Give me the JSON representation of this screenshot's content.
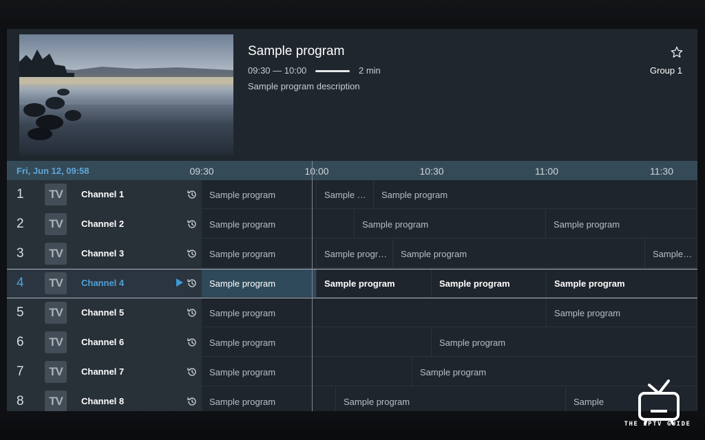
{
  "preview": {
    "title": "Sample program",
    "time_range": "09:30 — 10:00",
    "progress_fraction": 0.07,
    "remaining": "2 min",
    "description": "Sample program description",
    "group": "Group 1",
    "favorite_icon": "star-outline-icon"
  },
  "timebar": {
    "datetime": "Fri, Jun 12, 09:58",
    "ticks": [
      "09:30",
      "10:00",
      "10:30",
      "11:00",
      "11:30"
    ]
  },
  "channels": [
    {
      "number": "1",
      "logo": "TV",
      "name": "Channel 1",
      "selected": false,
      "programs": [
        [
          "Sample program",
          0,
          167
        ],
        [
          "Sample …",
          167,
          83
        ],
        [
          "Sample program",
          250,
          470
        ]
      ]
    },
    {
      "number": "2",
      "logo": "TV",
      "name": "Channel 2",
      "selected": false,
      "programs": [
        [
          "Sample program",
          0,
          222
        ],
        [
          "Sample program",
          222,
          278
        ],
        [
          "Sample program",
          500,
          220
        ]
      ]
    },
    {
      "number": "3",
      "logo": "TV",
      "name": "Channel 3",
      "selected": false,
      "programs": [
        [
          "Sample program",
          0,
          167
        ],
        [
          "Sample progr…",
          167,
          111
        ],
        [
          "Sample program",
          278,
          366
        ],
        [
          "Sample pro",
          644,
          76
        ]
      ]
    },
    {
      "number": "4",
      "logo": "TV",
      "name": "Channel 4",
      "selected": true,
      "programs": [
        [
          "Sample program",
          0,
          167
        ],
        [
          "Sample program",
          167,
          167
        ],
        [
          "Sample program",
          334,
          167
        ],
        [
          "Sample program",
          501,
          219
        ]
      ]
    },
    {
      "number": "5",
      "logo": "TV",
      "name": "Channel 5",
      "selected": false,
      "programs": [
        [
          "Sample program",
          0,
          501
        ],
        [
          "Sample program",
          501,
          219
        ]
      ]
    },
    {
      "number": "6",
      "logo": "TV",
      "name": "Channel 6",
      "selected": false,
      "programs": [
        [
          "Sample program",
          0,
          334
        ],
        [
          "Sample program",
          334,
          386
        ]
      ]
    },
    {
      "number": "7",
      "logo": "TV",
      "name": "Channel 7",
      "selected": false,
      "programs": [
        [
          "Sample program",
          0,
          306
        ],
        [
          "Sample program",
          306,
          414
        ]
      ]
    },
    {
      "number": "8",
      "logo": "TV",
      "name": "Channel 8",
      "selected": false,
      "programs": [
        [
          "Sample program",
          0,
          195
        ],
        [
          "Sample program",
          195,
          334
        ],
        [
          "Sample",
          529,
          191
        ]
      ]
    }
  ],
  "watermark": {
    "text": "THE IPTV GUIDE",
    "icon": "retro-tv-icon"
  },
  "colors": {
    "accent": "#4ea0d8",
    "timebar": "#344a57",
    "background": "#1f262d"
  }
}
